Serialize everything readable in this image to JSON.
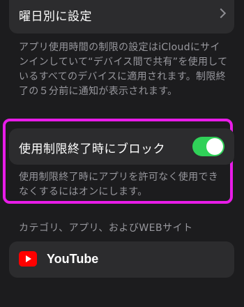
{
  "schedule_row": {
    "label": "曜日別に設定",
    "icon": "chevron-right-icon"
  },
  "icloud_note": "アプリ使用時間の制限の設定はiCloudにサインインしていて“デバイス間で共有”を使用しているすべてのデバイスに適用されます。制限終了の５分前に通知が表示されます。",
  "block_row": {
    "label": "使用制限終了時にブロック",
    "toggle_on": true,
    "toggle_color": "#30d158"
  },
  "block_note": "使用制限終了時にアプリを許可なく使用できなくするにはオンにします。",
  "section_header": "カテゴリ、アプリ、およびWEBサイト",
  "apps": [
    {
      "name": "YouTube",
      "icon": "youtube-icon",
      "icon_color": "#ff0000"
    }
  ],
  "highlight_color": "#e81ce8"
}
